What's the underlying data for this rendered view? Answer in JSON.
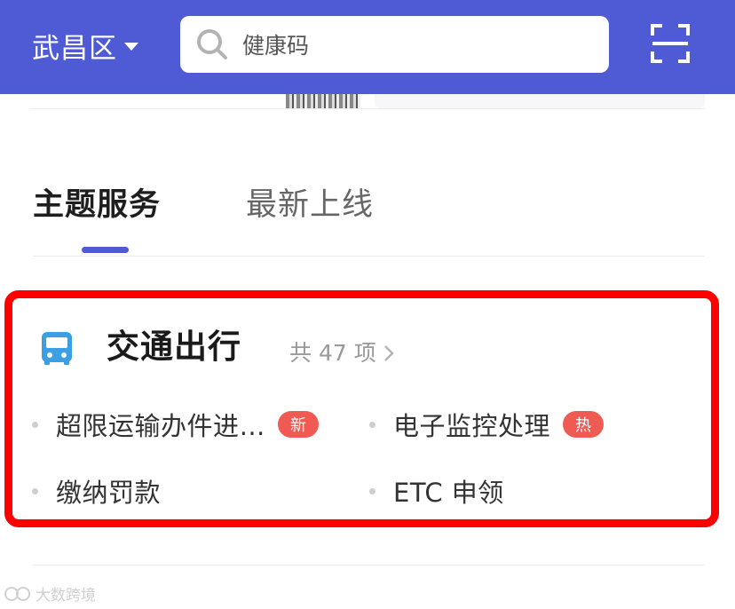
{
  "header": {
    "location": "武昌区",
    "search_text": "健康码",
    "accent_color": "#4f5bd5",
    "icons": [
      "chevron-down-icon",
      "search-icon",
      "scan-icon"
    ]
  },
  "tabs": [
    {
      "label": "主题服务",
      "active": true
    },
    {
      "label": "最新上线",
      "active": false
    }
  ],
  "section": {
    "title": "交通出行",
    "count": "共 47 项",
    "icon": "bus-icon",
    "items": [
      {
        "label": "超限运输办件进…",
        "badge": "新"
      },
      {
        "label": "电子监控处理",
        "badge": "热"
      },
      {
        "label": "缴纳罚款"
      },
      {
        "label": "ETC 申领"
      }
    ],
    "badge_color": "#ef5b52",
    "highlight_color": "#ff0000"
  },
  "watermark": {
    "text": "大数跨境"
  }
}
